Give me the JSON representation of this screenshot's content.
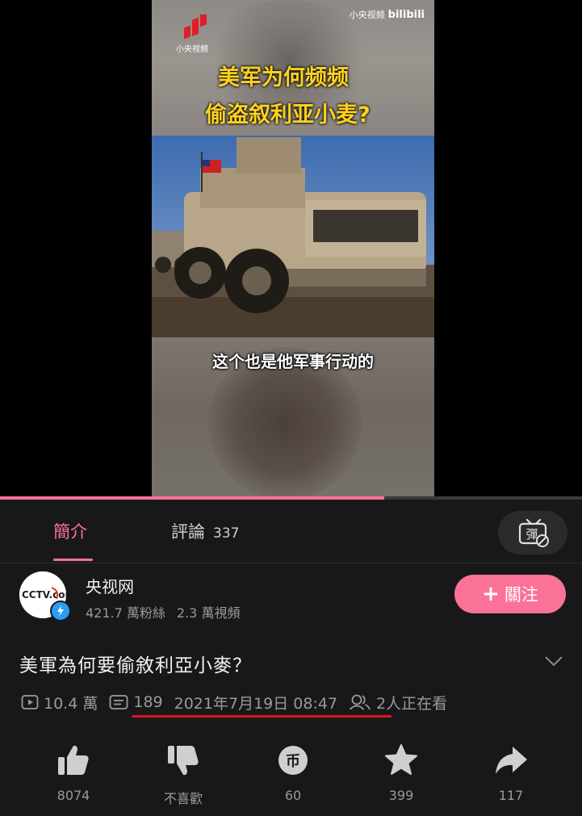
{
  "video": {
    "channel_logo_text": "小央视频",
    "watermark_source": "小央视频",
    "watermark_brand": "bilibili",
    "title_line1": "美军为何频频",
    "title_line2": "偷盗叙利亚小麦?",
    "subtitle": "这个也是他军事行动的",
    "progress": 0.66
  },
  "tabs": {
    "intro_label": "簡介",
    "comments_label": "評論",
    "comments_count": "337",
    "danmaku_icon_char": "彈"
  },
  "uploader": {
    "name": "央视网",
    "followers": "421.7 萬粉絲",
    "videos": "2.3 萬視頻",
    "follow_label": "關注",
    "avatar_text": "CCTV.com"
  },
  "detail": {
    "title": "美軍為何要偷敘利亞小麥？",
    "views": "10.4 萬",
    "danmaku_count": "189",
    "publish_time": "2021年7月19日 08:47",
    "watching": "2人正在看"
  },
  "actions": {
    "like": "8074",
    "dislike": "不喜歡",
    "coin": "60",
    "coin_char": "币",
    "favorite": "399",
    "share": "117"
  },
  "colors": {
    "accent_pink": "#fb7299",
    "background": "#18181a",
    "highlight_underline": "#e0141e"
  }
}
